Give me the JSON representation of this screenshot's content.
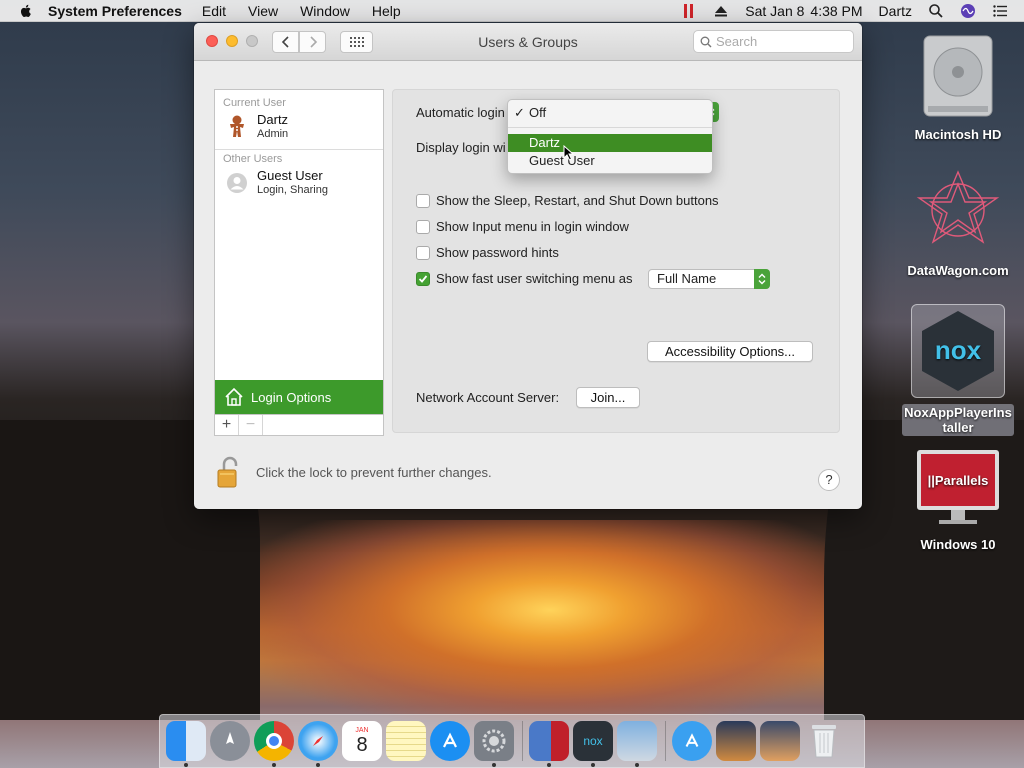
{
  "menubar": {
    "app_name": "System Preferences",
    "items": [
      "Edit",
      "View",
      "Window",
      "Help"
    ],
    "date": "Sat Jan 8",
    "time": "4:38 PM",
    "user": "Dartz"
  },
  "window": {
    "title": "Users & Groups",
    "search_placeholder": "Search"
  },
  "sidebar": {
    "current_user_header": "Current User",
    "current_user": {
      "name": "Dartz",
      "role": "Admin"
    },
    "other_users_header": "Other Users",
    "other_users": [
      {
        "name": "Guest User",
        "role": "Login, Sharing"
      }
    ],
    "login_options_label": "Login Options",
    "add_label": "+",
    "remove_label": "−"
  },
  "main": {
    "automatic_login_label": "Automatic login",
    "display_login_label": "Display login wi",
    "checkboxes": [
      {
        "label": "Show the Sleep, Restart, and Shut Down buttons",
        "checked": false
      },
      {
        "label": "Show Input menu in login window",
        "checked": false
      },
      {
        "label": "Show password hints",
        "checked": false
      },
      {
        "label": "Show fast user switching menu as",
        "checked": true
      }
    ],
    "fast_switch_value": "Full Name",
    "accessibility_button": "Accessibility Options...",
    "network_label": "Network Account Server:",
    "join_button": "Join..."
  },
  "dropdown": {
    "options": [
      "Off",
      "Dartz",
      "Guest User"
    ],
    "checked": "Off",
    "highlighted": "Dartz"
  },
  "footer": {
    "lock_text": "Click the lock to prevent further changes.",
    "help_label": "?"
  },
  "desktop": {
    "icons": [
      "Macintosh HD",
      "DataWagon.com",
      "NoxAppPlayerIns taller",
      "Windows 10"
    ]
  },
  "colors": {
    "accent_green": "#3e8d23",
    "close": "#fc5f57",
    "minimize": "#fdbc2e"
  }
}
